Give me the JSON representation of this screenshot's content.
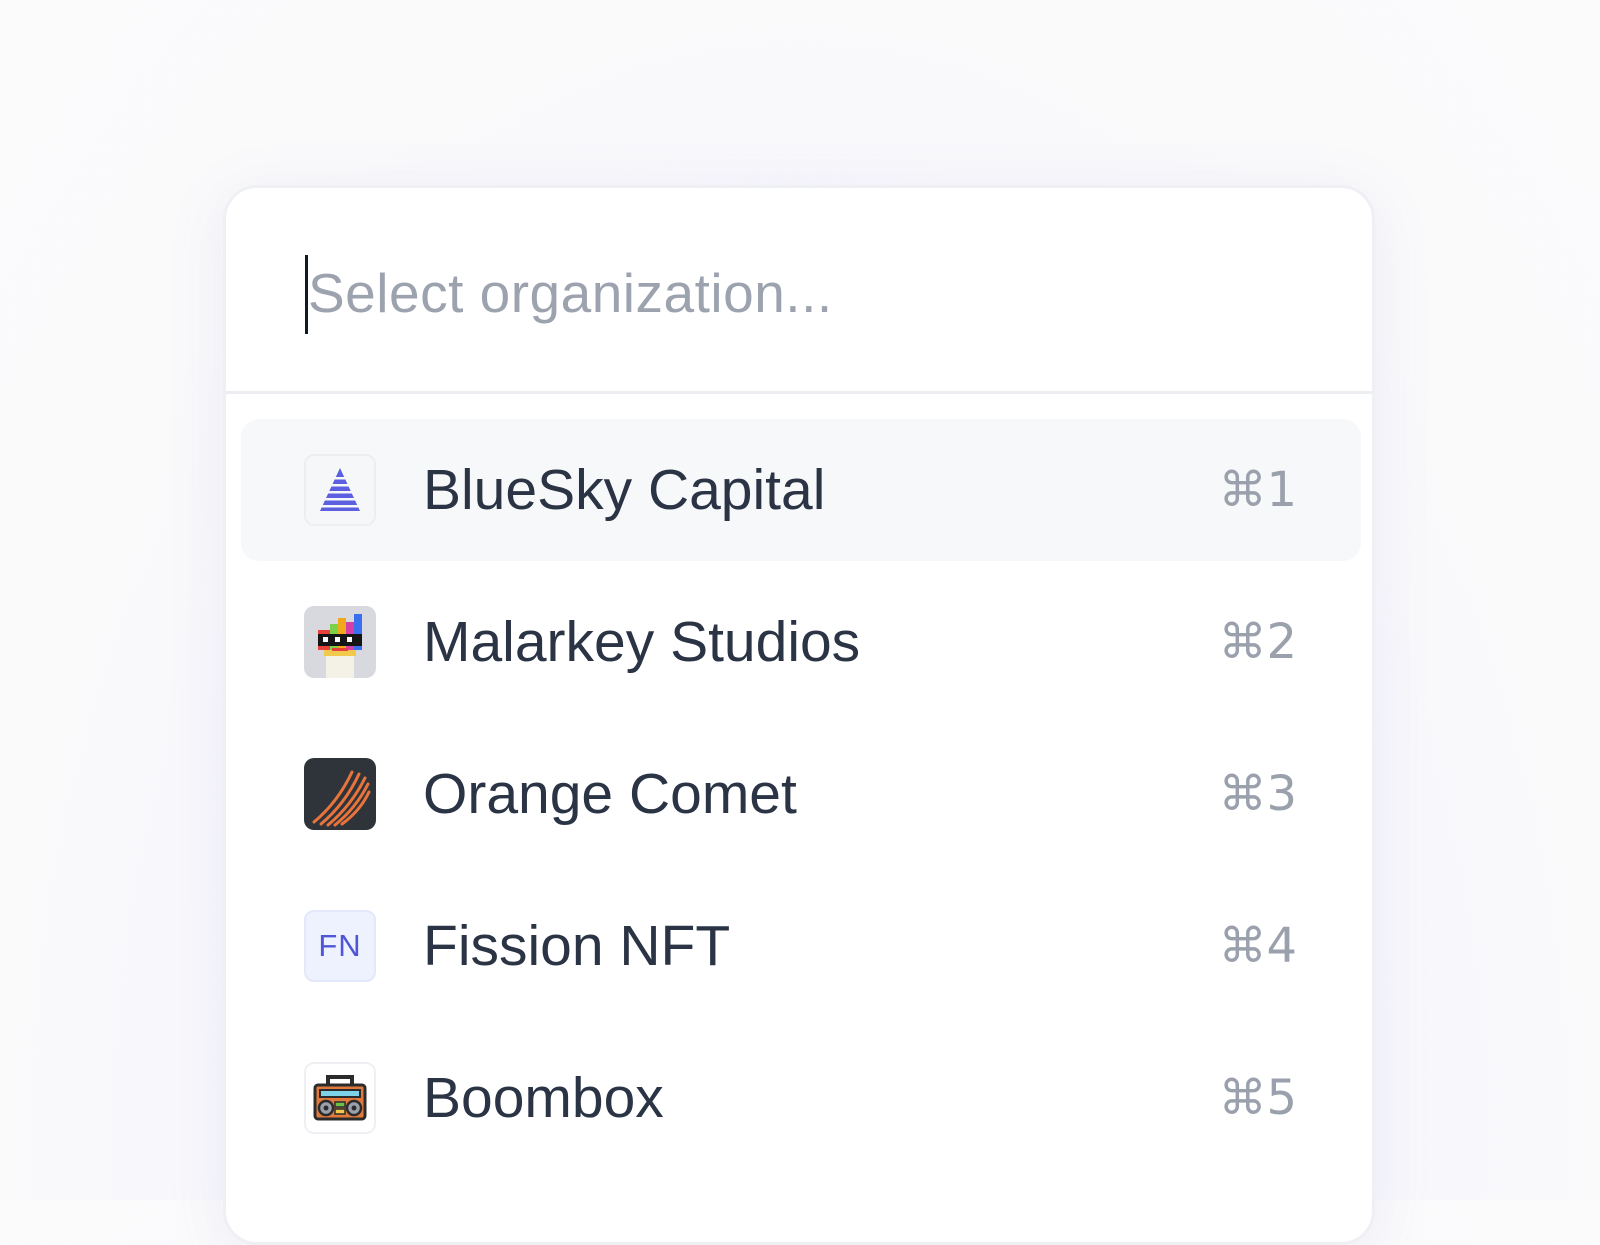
{
  "search": {
    "placeholder": "Select organization...",
    "value": ""
  },
  "organizations": [
    {
      "name": "BlueSky Capital",
      "shortcut": "⌘1",
      "logo_icon": "bluesky-pyramid-icon",
      "active": true
    },
    {
      "name": "Malarkey Studios",
      "shortcut": "⌘2",
      "logo_icon": "malarkey-pixel-avatar-icon",
      "active": false
    },
    {
      "name": "Orange Comet",
      "shortcut": "⌘3",
      "logo_icon": "orange-comet-streaks-icon",
      "active": false
    },
    {
      "name": "Fission NFT",
      "shortcut": "⌘4",
      "logo_icon": "fission-monogram-icon",
      "logo_text": "FN",
      "active": false
    },
    {
      "name": "Boombox",
      "shortcut": "⌘5",
      "logo_icon": "boombox-radio-icon",
      "active": false
    }
  ],
  "colors": {
    "bluesky_accent": "#5b5fe0",
    "orange_comet": "#e8743b",
    "fission_accent": "#4f55d6",
    "active_row_bg": "#f7f8fa"
  }
}
